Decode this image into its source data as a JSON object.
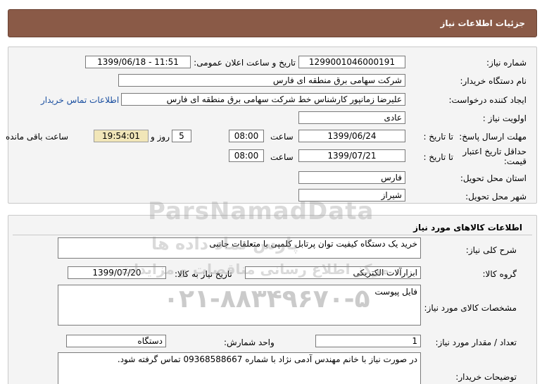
{
  "header": {
    "title": "جزئیات اطلاعات نیاز"
  },
  "need_info": {
    "need_number_label": "شماره نیاز:",
    "need_number": "1299001046000191",
    "announce_label": "تاریخ و ساعت اعلان عمومی:",
    "announce_value": "1399/06/18 - 11:51",
    "buyer_label": "نام دستگاه خریدار:",
    "buyer_value": "شرکت سهامی برق منطقه ای فارس",
    "creator_label": "ایجاد کننده درخواست:",
    "creator_value": "علیرضا زمانپور کارشناس خط شرکت سهامی برق منطقه ای فارس",
    "contact_link": "اطلاعات تماس خریدار",
    "priority_label": "اولویت نیاز :",
    "priority_value": "عادی",
    "deadline_label": "مهلت ارسال پاسخ:",
    "to_date_label": "تا تاریخ :",
    "deadline_date": "1399/06/24",
    "time_label": "ساعت",
    "deadline_time": "08:00",
    "days_value": "5",
    "days_label": "روز و",
    "remaining_time": "19:54:01",
    "remaining_label": "ساعت باقی مانده",
    "validity_label": "حداقل تاریخ اعتبار قیمت:",
    "validity_date": "1399/07/21",
    "validity_time": "08:00",
    "province_label": "استان محل تحویل:",
    "province_value": "فارس",
    "city_label": "شهر محل تحویل:",
    "city_value": "شیراز"
  },
  "goods_info": {
    "section_title": "اطلاعات کالاهای مورد نیاز",
    "summary_label": "شرح کلی نیاز:",
    "summary_value": "خرید یک دستگاه کیفیت توان پرتابل کلمپی با متعلقات جانبی",
    "group_label": "گروه کالا:",
    "group_value": "ابزارآلات الکتریکی",
    "need_date_label": "تاریخ نیاز به کالا:",
    "need_date_value": "1399/07/20",
    "specs_label": "مشخصات کالای مورد نیاز:",
    "specs_value": "فایل پیوست",
    "qty_label": "تعداد / مقدار مورد نیاز:",
    "qty_value": "1",
    "unit_label": "واحد شمارش:",
    "unit_value": "دستگاه",
    "notes_label": "توضیحات خریدار:",
    "notes_value": "در صورت نیاز با خانم مهندس آدمی نژاد با شماره 09368588667 تماس گرفته شود."
  },
  "watermark": {
    "brand": "ParsNamadData",
    "line1": "پارس نماد داده ها",
    "line2": "مرکز اطلاع رسانی مناقصات و مزایدات",
    "phone": "۰۲۱-۸۸۳۴۹۶۷۰-۵"
  }
}
